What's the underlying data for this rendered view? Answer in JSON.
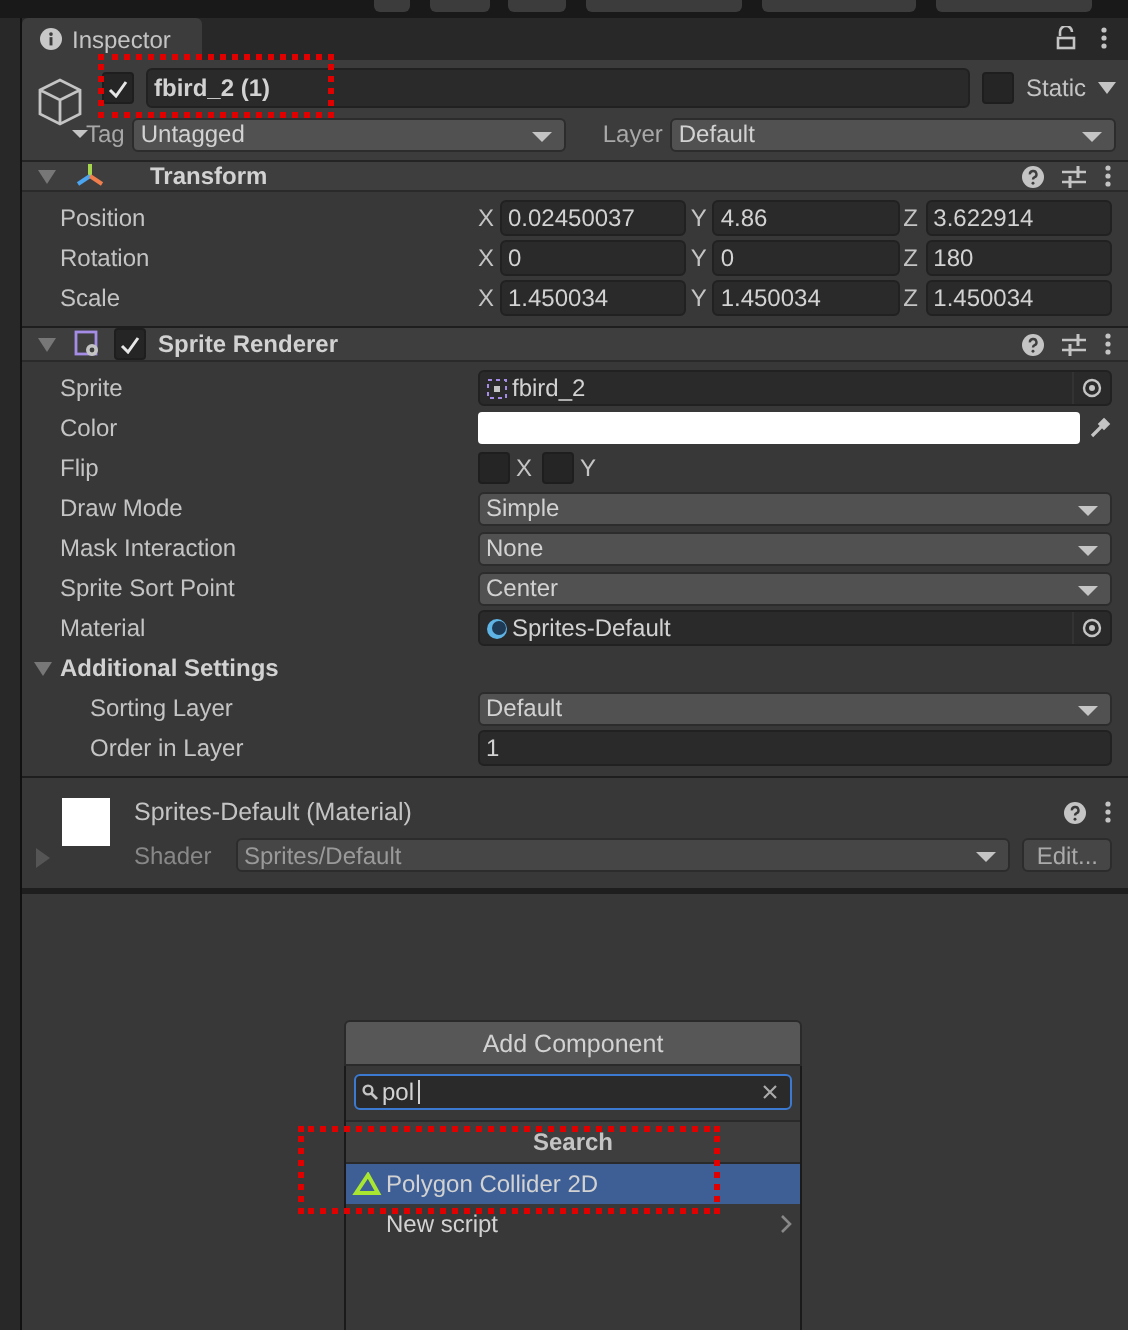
{
  "tab": {
    "title": "Inspector"
  },
  "object": {
    "active": true,
    "name": "fbird_2 (1)",
    "static_label": "Static",
    "static": false,
    "tag_label": "Tag",
    "tag": "Untagged",
    "layer_label": "Layer",
    "layer": "Default"
  },
  "transform": {
    "title": "Transform",
    "expanded": true,
    "rows": [
      {
        "label": "Position",
        "fields": [
          {
            "axis": "X",
            "value": "0.02450037"
          },
          {
            "axis": "Y",
            "value": "4.86"
          },
          {
            "axis": "Z",
            "value": "3.622914"
          }
        ]
      },
      {
        "label": "Rotation",
        "fields": [
          {
            "axis": "X",
            "value": "0"
          },
          {
            "axis": "Y",
            "value": "0"
          },
          {
            "axis": "Z",
            "value": "180"
          }
        ]
      },
      {
        "label": "Scale",
        "fields": [
          {
            "axis": "X",
            "value": "1.450034"
          },
          {
            "axis": "Y",
            "value": "1.450034"
          },
          {
            "axis": "Z",
            "value": "1.450034"
          }
        ]
      }
    ]
  },
  "sprite_renderer": {
    "title": "Sprite Renderer",
    "enabled": true,
    "expanded": true,
    "properties": [
      {
        "kind": "sprite_object",
        "label": "Sprite",
        "value": "fbird_2"
      },
      {
        "kind": "color",
        "label": "Color",
        "color": "#ffffff"
      },
      {
        "kind": "flip",
        "label": "Flip",
        "options": [
          {
            "label": "X",
            "checked": false
          },
          {
            "label": "Y",
            "checked": false
          }
        ]
      },
      {
        "kind": "dropdown",
        "label": "Draw Mode",
        "value": "Simple"
      },
      {
        "kind": "dropdown",
        "label": "Mask Interaction",
        "value": "None"
      },
      {
        "kind": "dropdown",
        "label": "Sprite Sort Point",
        "value": "Center"
      },
      {
        "kind": "material_object",
        "label": "Material",
        "value": "Sprites-Default"
      },
      {
        "kind": "section",
        "label": "Additional Settings",
        "expanded": true,
        "children": [
          {
            "kind": "dropdown",
            "label": "Sorting Layer",
            "value": "Default"
          },
          {
            "kind": "int",
            "label": "Order in Layer",
            "value": "1"
          }
        ]
      }
    ]
  },
  "material": {
    "title": "Sprites-Default (Material)",
    "expanded": false,
    "shader_label": "Shader",
    "shader": "Sprites/Default",
    "edit_button": "Edit..."
  },
  "add_component": {
    "button": "Add Component",
    "search": {
      "value": "pol"
    },
    "header": "Search",
    "results": [
      {
        "label": "Polygon Collider 2D",
        "kind": "component",
        "selected": true
      },
      {
        "label": "New script",
        "kind": "submenu",
        "selected": false
      }
    ]
  }
}
